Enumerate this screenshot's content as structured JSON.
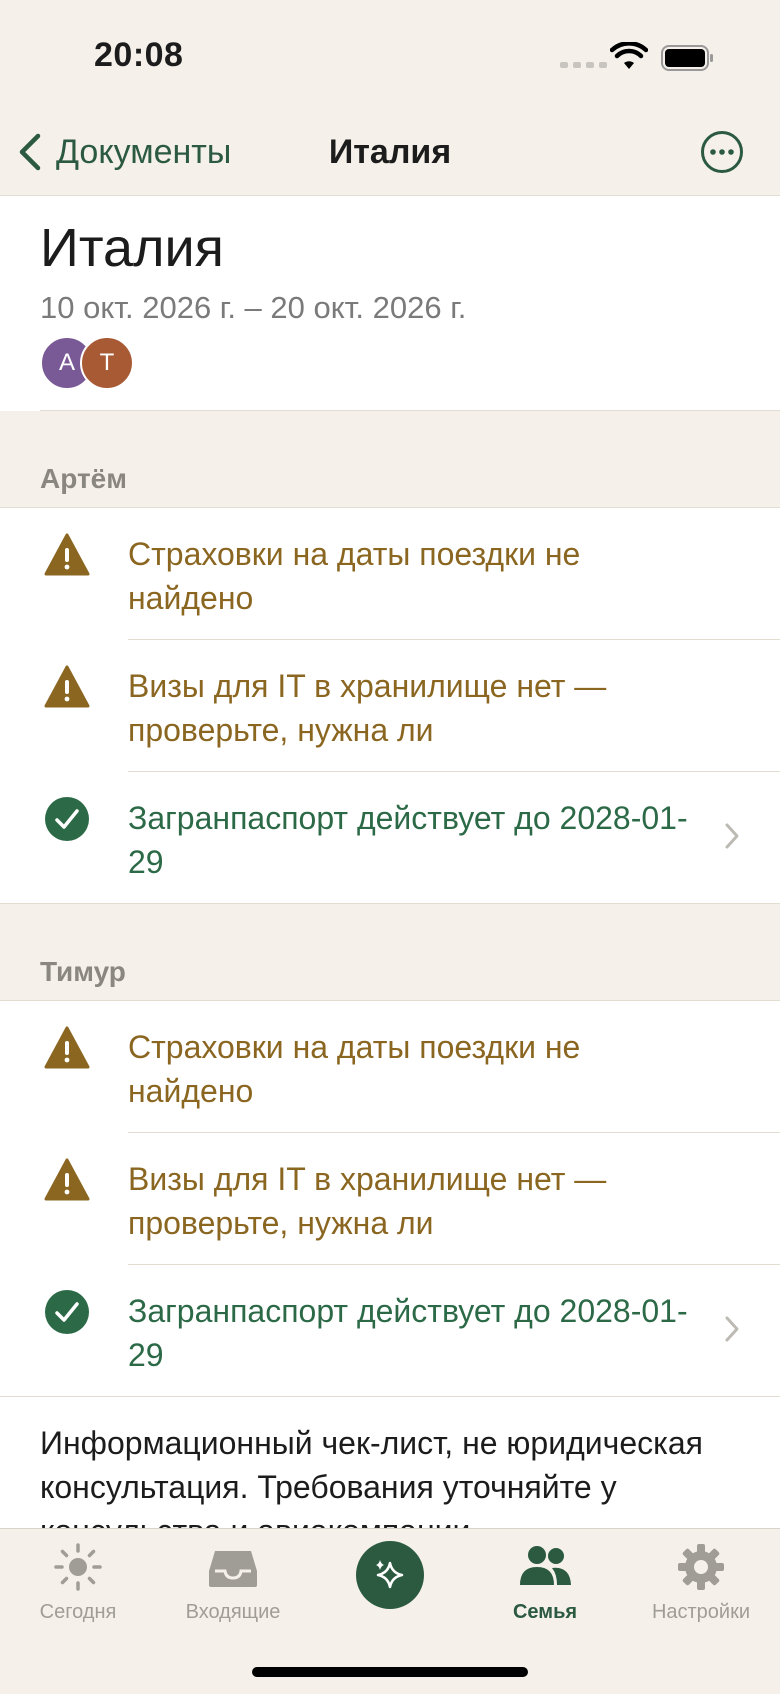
{
  "status_bar": {
    "time": "20:08"
  },
  "nav": {
    "back_label": "Документы",
    "title": "Италия"
  },
  "trip": {
    "title": "Италия",
    "dates": "10 окт. 2026 г. – 20 окт. 2026 г.",
    "avatars": [
      {
        "initial": "А",
        "color": "#7a5a96"
      },
      {
        "initial": "Т",
        "color": "#a85a35"
      }
    ]
  },
  "sections": [
    {
      "name": "Артём",
      "items": [
        {
          "status": "warning",
          "text": "Страховки на даты поездки не найдено"
        },
        {
          "status": "warning",
          "text": "Визы для IT в хранилище нет — проверьте, нужна ли"
        },
        {
          "status": "ok",
          "text": "Загранпаспорт действует до 2028-01-29"
        }
      ]
    },
    {
      "name": "Тимур",
      "items": [
        {
          "status": "warning",
          "text": "Страховки на даты поездки не найдено"
        },
        {
          "status": "warning",
          "text": "Визы для IT в хранилище нет — проверьте, нужна ли"
        },
        {
          "status": "ok",
          "text": "Загранпаспорт действует до 2028-01-29"
        }
      ]
    }
  ],
  "disclaimer": "Информационный чек-лист, не юридическая консультация. Требования уточняйте у консульства и авиакомпании.",
  "tabs": {
    "today": "Сегодня",
    "inbox": "Входящие",
    "family": "Семья",
    "settings": "Настройки"
  },
  "colors": {
    "accent": "#2b5a40",
    "warning": "#8a6621",
    "ok": "#2c6a47",
    "background": "#f5f1ea"
  }
}
